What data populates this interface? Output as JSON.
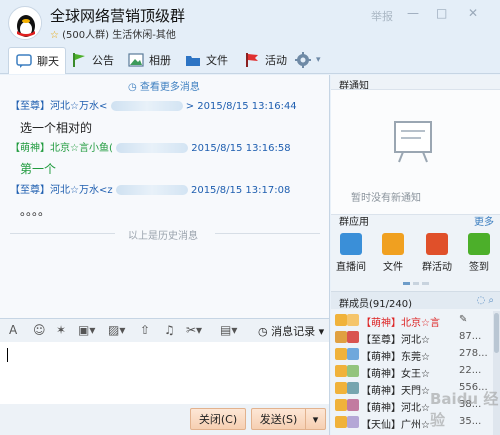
{
  "window": {
    "group_name": "全球网络营销顶级群",
    "group_sub_star": "☆",
    "group_sub": "(500人群) 生活休闲-其他",
    "report_label": "举报",
    "minimize": "—",
    "maximize": "□",
    "close": "✕"
  },
  "tabs": [
    {
      "label": "聊天"
    },
    {
      "label": "公告"
    },
    {
      "label": "相册"
    },
    {
      "label": "文件"
    },
    {
      "label": "活动"
    }
  ],
  "chat": {
    "more_messages": "查看更多消息",
    "messages": [
      {
        "name": "【至尊】河北☆万水<",
        "name_tail": ">",
        "time": "2015/8/15 13:16:44",
        "body": "选一个相对的"
      },
      {
        "name": "【萌神】北京☆言小鱼(",
        "name_tail": "",
        "time": "2015/8/15 13:16:58",
        "body": "第一个"
      },
      {
        "name": "【至尊】河北☆万水<z",
        "name_tail": "",
        "time": "2015/8/15 13:17:08",
        "body": "。。。。"
      }
    ],
    "history_divider": "以上是历史消息"
  },
  "right_panel": {
    "notice_title": "群通知",
    "no_notice": "暂时没有新通知",
    "apps_title": "群应用",
    "more_label": "更多",
    "apps": [
      {
        "label": "直播间",
        "color": "#3a8fd8"
      },
      {
        "label": "文件",
        "color": "#f0a020"
      },
      {
        "label": "群活动",
        "color": "#e0502a"
      },
      {
        "label": "签到",
        "color": "#4caf2a"
      }
    ],
    "members_title": "群成员(91/240)",
    "members": [
      {
        "role": "【萌神】",
        "name": "北京☆言",
        "trail": "",
        "highlight": true
      },
      {
        "role": "【至尊】",
        "name": "河北☆",
        "trail": "87...",
        "highlight": false
      },
      {
        "role": "【萌神】",
        "name": "东莞☆",
        "trail": "278...",
        "highlight": false
      },
      {
        "role": "【萌神】",
        "name": "女王☆",
        "trail": "22...",
        "highlight": false
      },
      {
        "role": "【萌神】",
        "name": "天門☆",
        "trail": "556...",
        "highlight": false
      },
      {
        "role": "【萌神】",
        "name": "河北☆",
        "trail": "38...",
        "highlight": false
      },
      {
        "role": "【天仙】",
        "name": "广州☆",
        "trail": "35...",
        "highlight": false
      }
    ]
  },
  "input": {
    "history_label": "消息记录",
    "close_button": "关闭(C)",
    "send_button": "发送(S)"
  },
  "watermark": "Baidu 经验"
}
